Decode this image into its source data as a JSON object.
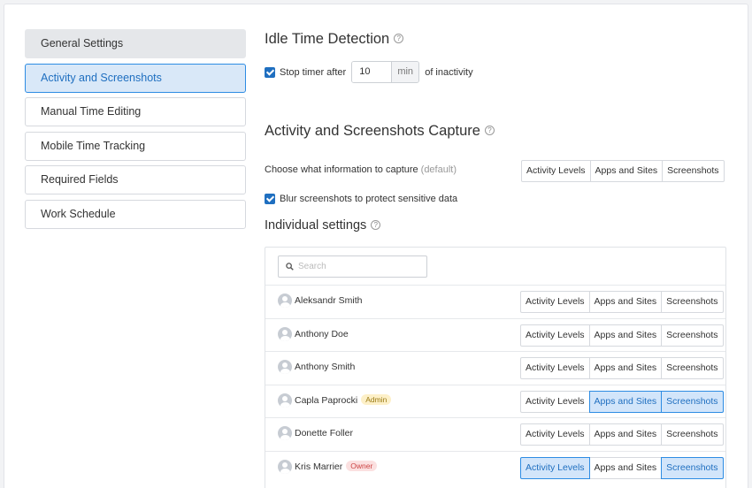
{
  "sidebar": {
    "items": [
      {
        "label": "General Settings"
      },
      {
        "label": "Activity and Screenshots"
      },
      {
        "label": "Manual Time Editing"
      },
      {
        "label": "Mobile Time Tracking"
      },
      {
        "label": "Required Fields"
      },
      {
        "label": "Work Schedule"
      }
    ]
  },
  "idle": {
    "title": "Idle Time Detection",
    "help": "?",
    "stop_label": "Stop timer after",
    "value": "10",
    "unit": "min",
    "suffix": "of inactivity"
  },
  "capture": {
    "title": "Activity and Screenshots Capture",
    "help": "?",
    "choose_label": "Choose what information to capture",
    "default_hint": "(default)",
    "options": [
      "Activity Levels",
      "Apps and Sites",
      "Screenshots"
    ],
    "blur_label": "Blur screenshots to protect sensitive data"
  },
  "individual": {
    "title": "Individual settings",
    "help": "?",
    "search_placeholder": "Search",
    "options": [
      "Activity Levels",
      "Apps and Sites",
      "Screenshots"
    ],
    "users": [
      {
        "name": "Aleksandr Smith",
        "badge": "",
        "on": [
          false,
          false,
          false
        ]
      },
      {
        "name": "Anthony Doe",
        "badge": "",
        "on": [
          false,
          false,
          false
        ]
      },
      {
        "name": "Anthony Smith",
        "badge": "",
        "on": [
          false,
          false,
          false
        ]
      },
      {
        "name": "Capla Paprocki",
        "badge": "Admin",
        "on": [
          false,
          true,
          true
        ]
      },
      {
        "name": "Donette Foller",
        "badge": "",
        "on": [
          false,
          false,
          false
        ]
      },
      {
        "name": "Kris Marrier",
        "badge": "Owner",
        "on": [
          true,
          false,
          true
        ]
      }
    ]
  },
  "colors": {
    "accent": "#2d8ce3",
    "accent_fill": "#d2e5fa",
    "admin_badge": "#fdf0c8",
    "owner_badge": "#fbe0e0"
  }
}
